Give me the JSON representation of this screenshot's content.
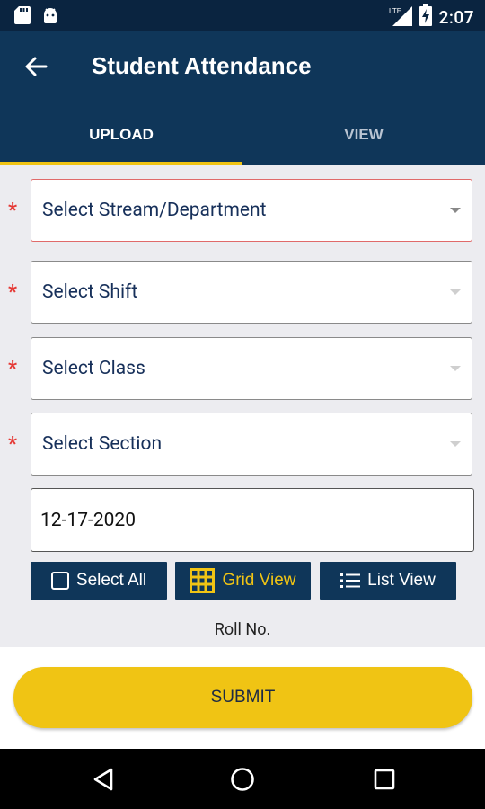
{
  "status_bar": {
    "time": "2:07",
    "network_label": "LTE",
    "icons": [
      "sd-card-icon",
      "android-icon",
      "lte-signal-icon",
      "battery-charging-icon"
    ]
  },
  "app_bar": {
    "title": "Student Attendance",
    "back_icon": "arrow-back-icon"
  },
  "tabs": [
    {
      "label": "UPLOAD",
      "active": true
    },
    {
      "label": "VIEW",
      "active": false
    }
  ],
  "form": {
    "required_marker": "*",
    "stream": {
      "placeholder": "Select Stream/Department"
    },
    "shift": {
      "placeholder": "Select Shift"
    },
    "class": {
      "placeholder": "Select Class"
    },
    "section": {
      "placeholder": "Select Section"
    },
    "date": {
      "value": "12-17-2020"
    }
  },
  "view_controls": {
    "select_all": "Select All",
    "grid_view": "Grid View",
    "list_view": "List View"
  },
  "roll_header": "Roll No.",
  "submit_label": "SUBMIT",
  "colors": {
    "primary": "#0f3659",
    "accent": "#f0c414",
    "error": "#e53935"
  }
}
